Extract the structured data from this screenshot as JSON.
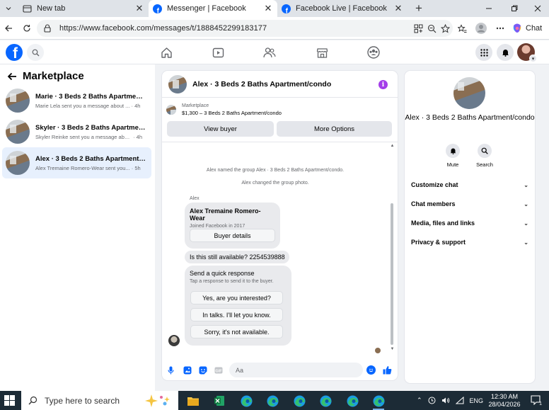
{
  "browser": {
    "tabs": [
      {
        "label": "New tab",
        "active": false
      },
      {
        "label": "Messenger | Facebook",
        "active": true
      },
      {
        "label": "Facebook Live | Facebook",
        "active": false
      }
    ],
    "url": "https://www.facebook.com/messages/t/1888452299183177",
    "chat_label": "Chat"
  },
  "fb_nav": {
    "icons": [
      "home-icon",
      "video-icon",
      "friends-icon",
      "marketplace-icon",
      "groups-icon"
    ],
    "right_icons": [
      "menu-grid-icon",
      "messenger-icon",
      "notifications-icon"
    ]
  },
  "left_panel": {
    "title": "Marketplace",
    "conversations": [
      {
        "name": "Marie · 3 Beds 2 Baths Apartment/...",
        "snippet": "Marie Lela sent you a message about ...",
        "time": "· 4h",
        "selected": false
      },
      {
        "name": "Skyler · 3 Beds 2 Baths Apartment...",
        "snippet": "Skyler Reinke sent you a message abo...",
        "time": "· 4h",
        "selected": false
      },
      {
        "name": "Alex · 3 Beds 2 Baths Apartment/c...",
        "snippet": "Alex Tremaine Romero-Wear sent you...",
        "time": "· 5h",
        "selected": true
      }
    ]
  },
  "chat": {
    "title": "Alex · 3 Beds 2 Baths Apartment/condo",
    "marketplace_label": "Marketplace",
    "listing_price": "$1,300 – 3 Beds 2 Baths Apartment/condo",
    "view_buyer": "View buyer",
    "more_options": "More Options",
    "system_messages": [
      "Alex named the group Alex · 3 Beds 2 Baths Apartment/condo.",
      "Alex changed the group photo."
    ],
    "sender_label": "Alex",
    "buyer_card": {
      "name": "Alex Tremaine Romero-Wear",
      "joined": "Joined Facebook in 2017",
      "button": "Buyer details"
    },
    "message": "Is this still available? 2254539888",
    "quick_response": {
      "title": "Send a quick response",
      "subtitle": "Tap a response to send it to the buyer.",
      "options": [
        "Yes, are you interested?",
        "In talks. I'll let you know.",
        "Sorry, it's not available."
      ]
    },
    "composer_placeholder": "Aa"
  },
  "details": {
    "title": "Alex · 3 Beds 2 Baths Apartment/condo",
    "mute_label": "Mute",
    "search_label": "Search",
    "sections": [
      "Customize chat",
      "Chat members",
      "Media, files and links",
      "Privacy & support"
    ]
  },
  "taskbar": {
    "search_placeholder": "Type here to search",
    "language": "ENG",
    "time": "12:30 AM",
    "date": "28/04/2026",
    "notification_count": "1"
  },
  "colors": {
    "fb_blue": "#0866ff",
    "info_purple": "#a43ee9",
    "selected_bg": "#e7f0fd",
    "taskbar_bg": "#1c2b36"
  }
}
